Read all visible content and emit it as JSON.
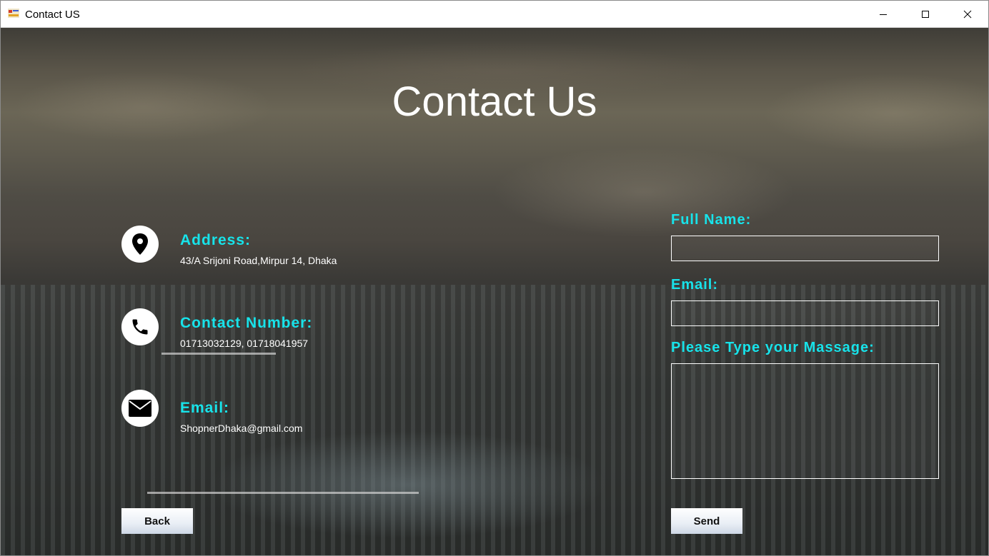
{
  "window": {
    "title": "Contact US"
  },
  "page": {
    "title": "Contact Us"
  },
  "info": [
    {
      "label": "Address:",
      "value": "43/A Srijoni Road,Mirpur 14, Dhaka",
      "icon": "location-pin-icon"
    },
    {
      "label": "Contact Number:",
      "value": "01713032129, 01718041957",
      "icon": "phone-icon"
    },
    {
      "label": "Email:",
      "value": "ShopnerDhaka@gmail.com",
      "icon": "envelope-icon"
    }
  ],
  "form": {
    "full_name_label": "Full Name:",
    "full_name_value": "",
    "email_label": "Email:",
    "email_value": "",
    "message_label": "Please Type your Massage:",
    "message_value": ""
  },
  "buttons": {
    "back": "Back",
    "send": "Send"
  },
  "colors": {
    "accent": "#17e3ea",
    "text": "#ffffff"
  }
}
